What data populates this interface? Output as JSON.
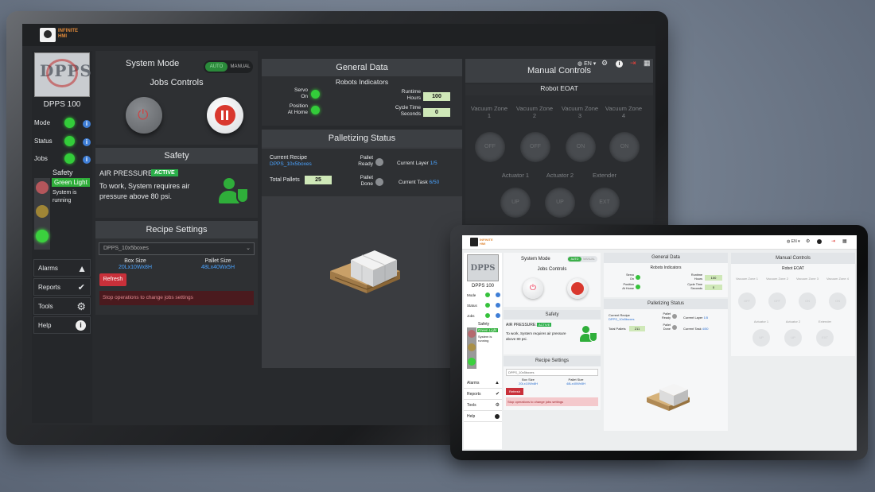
{
  "brand": {
    "logo_line1": "INFINITE",
    "logo_line2": "HMI"
  },
  "header": {
    "lang": "EN"
  },
  "sidebar": {
    "machine_name": "DPPS 100",
    "logo_text": "DPPS",
    "indicators": [
      {
        "label": "Mode"
      },
      {
        "label": "Status"
      },
      {
        "label": "Jobs"
      }
    ],
    "safety_title": "Safety",
    "safety_light": "Green Light",
    "safety_message": "System is running",
    "menu": [
      {
        "label": "Alarms"
      },
      {
        "label": "Reports"
      },
      {
        "label": "Tools"
      },
      {
        "label": "Help"
      }
    ]
  },
  "system_mode": {
    "title": "System Mode",
    "auto": "AUTO",
    "manual": "MANUAL"
  },
  "jobs_controls": {
    "title": "Jobs Controls"
  },
  "safety": {
    "title": "Safety",
    "air_label": "AIR PRESSURE:",
    "air_status": "ACTIVE",
    "message": "To work, System requires air pressure above 80 psi."
  },
  "recipe": {
    "title": "Recipe Settings",
    "selected": "DPPS_10x5boxes",
    "box_label": "Box Size",
    "box_value": "20Lx10Wx8H",
    "pallet_label": "Pallet Size",
    "pallet_value": "48Lx40Wx5H",
    "refresh": "Refresh",
    "warning": "Stop operations to change jobs settings"
  },
  "general": {
    "title": "General Data",
    "robots_title": "Robots Indicators",
    "servo_label": "Servo",
    "servo_sub": "On",
    "position_label": "Position",
    "position_sub": "At Home",
    "runtime_label": "Runtime",
    "runtime_sub": "Hours",
    "runtime_value": "100",
    "cycle_label": "Cycle Time",
    "cycle_sub": "Seconds",
    "cycle_value": "0"
  },
  "palletizing": {
    "title": "Palletizing Status",
    "current_recipe_label": "Current Recipe",
    "current_recipe_value": "DPPS_10x5boxes",
    "total_label": "Total Pallets",
    "total_value": "25",
    "ready_label": "Pallet",
    "ready_sub": "Ready",
    "done_label": "Pallet",
    "done_sub": "Done",
    "layer_label": "Current Layer",
    "layer_value": "1/5",
    "task_label": "Current Task",
    "task_value": "6/50"
  },
  "manual": {
    "title": "Manual Controls",
    "eoat_title": "Robot EOAT",
    "zones": [
      {
        "label": "Vacuum Zone 1",
        "btn": "OFF"
      },
      {
        "label": "Vacuum Zone 2",
        "btn": "OFF"
      },
      {
        "label": "Vacuum Zone 3",
        "btn": "ON"
      },
      {
        "label": "Vacuum Zone 4",
        "btn": "ON"
      }
    ],
    "actuators": [
      {
        "label": "Actuator 1",
        "btn": "UP"
      },
      {
        "label": "Actuator 2",
        "btn": "UP"
      },
      {
        "label": "Extender",
        "btn": "EXT"
      }
    ]
  },
  "tablet": {
    "total_value": "211",
    "runtime_value": "100",
    "cycle_value": "0",
    "layer_value": "1/5",
    "task_value": "4/50"
  },
  "colors": {
    "accent_green": "#33cc3a",
    "active_badge": "#2bb04a",
    "info_blue": "#3f7ed6",
    "refresh_red": "#c9303a",
    "warning_bg": "#4a1a1e",
    "link_blue": "#4aa3ff"
  }
}
